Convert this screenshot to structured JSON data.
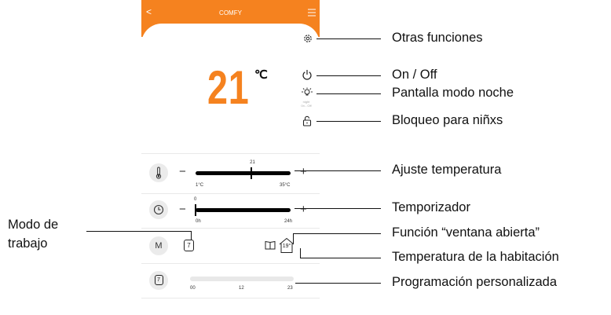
{
  "header": {
    "title": "COMFY",
    "back_icon": "chevron-left-icon",
    "menu_icon": "hamburger-menu-icon"
  },
  "main": {
    "temperature": "21",
    "unit": "℃",
    "night_label": "night\n0n - Off",
    "night_label_line1": "night",
    "night_label_line2": "0n - Off"
  },
  "temp_slider": {
    "value_label": "21",
    "value": 21,
    "min": 1,
    "max": 35,
    "min_label": "1°C",
    "max_label": "35°C",
    "minus": "−",
    "plus": "+"
  },
  "timer_slider": {
    "value_label": "0",
    "value": 0,
    "min": 0,
    "max": 24,
    "min_label": "0h",
    "max_label": "24h",
    "minus": "−",
    "plus": "+"
  },
  "mode": {
    "button_label": "M",
    "week_icon_label": "7",
    "room_temp": "19°"
  },
  "schedule": {
    "icon_label": "7",
    "ticks": [
      "00",
      "12",
      "23"
    ]
  },
  "annotations": {
    "other_functions": "Otras funciones",
    "on_off": "On / Off",
    "night_mode": "Pantalla modo noche",
    "child_lock": "Bloqueo para niñxs",
    "temp_adjust": "Ajuste temperatura",
    "timer": "Temporizador",
    "open_window": "Función “ventana abierta”",
    "room_temp": "Temperatura de la habitación",
    "custom_schedule": "Programación personalizada",
    "work_mode_line1": "Modo de",
    "work_mode_line2": "trabajo"
  },
  "colors": {
    "accent": "#f5821f",
    "track": "#000000",
    "circle_bg": "#ebebeb"
  }
}
